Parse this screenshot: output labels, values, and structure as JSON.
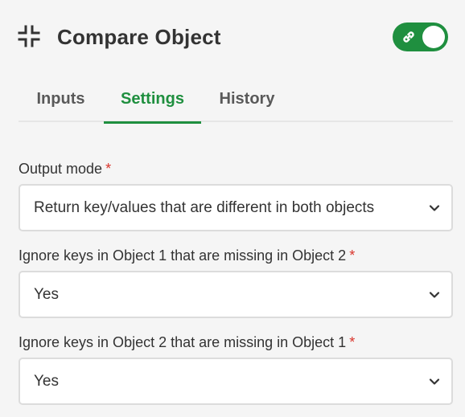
{
  "header": {
    "title": "Compare Object",
    "collapse_icon": "collapse-icon",
    "toggle": {
      "state": "on",
      "icon": "link-icon",
      "color": "#1f8f3f"
    }
  },
  "tabs": [
    {
      "label": "Inputs",
      "active": false
    },
    {
      "label": "Settings",
      "active": true
    },
    {
      "label": "History",
      "active": false
    }
  ],
  "fields": [
    {
      "label": "Output mode",
      "required_mark": "*",
      "value": "Return key/values that are different in both objects"
    },
    {
      "label": "Ignore keys in Object 1 that are missing in Object 2",
      "required_mark": "*",
      "value": "Yes"
    },
    {
      "label": "Ignore keys in Object 2 that are missing in Object 1",
      "required_mark": "*",
      "value": "Yes"
    }
  ],
  "colors": {
    "accent": "#1f8f3f",
    "required": "#d9342b"
  }
}
